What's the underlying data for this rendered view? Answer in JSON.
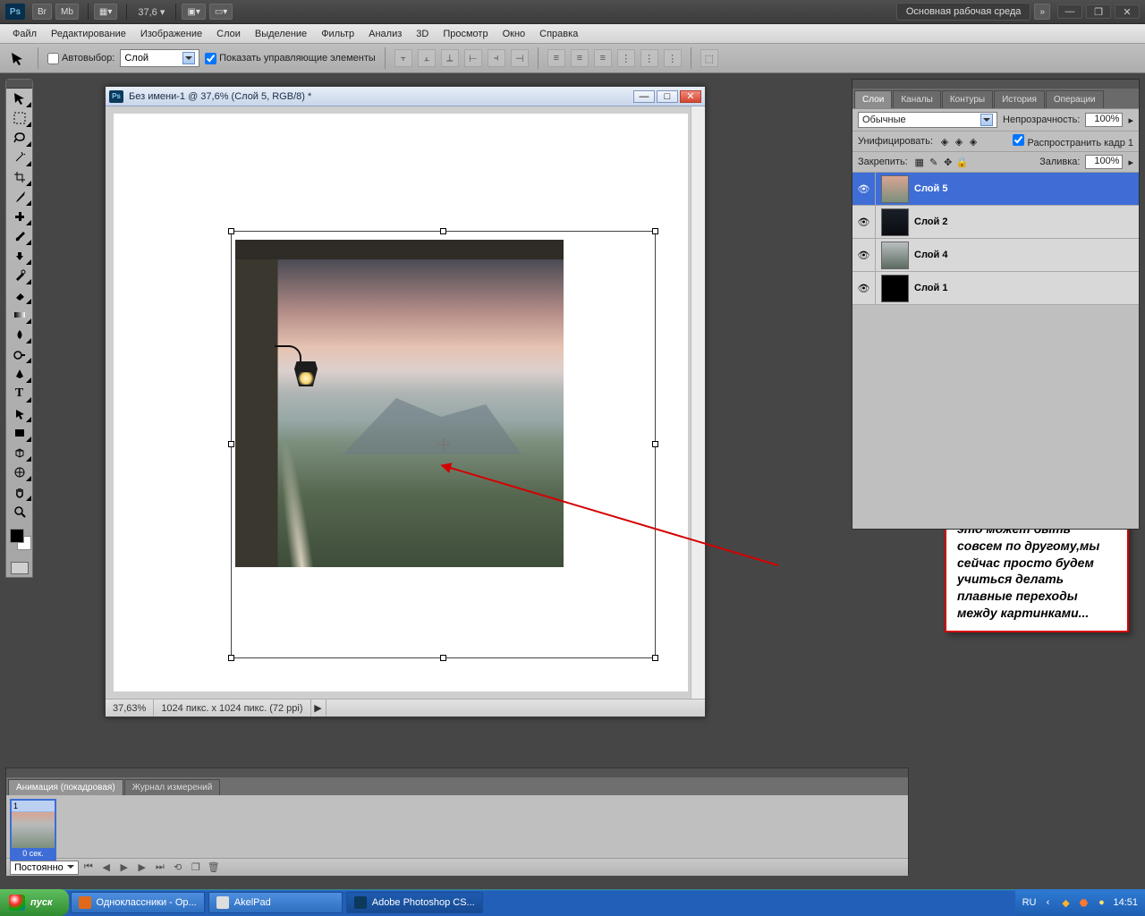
{
  "appbar": {
    "br_label": "Br",
    "mb_label": "Mb",
    "zoom": "37,6",
    "workspace_label": "Основная рабочая среда"
  },
  "menus": [
    "Файл",
    "Редактирование",
    "Изображение",
    "Слои",
    "Выделение",
    "Фильтр",
    "Анализ",
    "3D",
    "Просмотр",
    "Окно",
    "Справка"
  ],
  "options": {
    "auto_select": "Автовыбор:",
    "target_select": "Слой",
    "show_controls": "Показать управляющие элементы"
  },
  "document": {
    "title": "Без имени-1 @ 37,6% (Слой 5, RGB/8) *",
    "zoom": "37,63%",
    "info": "1024 пикс. x 1024 пикс. (72 ppi)"
  },
  "panels": {
    "tabs": [
      "Слои",
      "Каналы",
      "Контуры",
      "История",
      "Операции"
    ],
    "blend_mode": "Обычные",
    "opacity_label": "Непрозрачность:",
    "opacity_value": "100%",
    "unify_label": "Унифицировать:",
    "propagate_label": "Распространить кадр 1",
    "lock_label": "Закрепить:",
    "fill_label": "Заливка:",
    "fill_value": "100%",
    "layers": [
      {
        "name": "Слой 5",
        "thumb": "sky",
        "selected": true
      },
      {
        "name": "Слой 2",
        "thumb": "dark",
        "selected": false
      },
      {
        "name": "Слой 4",
        "thumb": "photo",
        "selected": false
      },
      {
        "name": "Слой 1",
        "thumb": "black",
        "selected": false
      }
    ]
  },
  "animation": {
    "tabs": [
      "Анимация (покадровая)",
      "Журнал измерений"
    ],
    "frame_num": "1",
    "frame_dur": "0 сек.",
    "loop": "Постоянно"
  },
  "callout_text": "вот так примерно я это поставила,но у вас это может быть совсем по другому,мы сейчас просто будем учиться делать плавные переходы между картинками...",
  "taskbar": {
    "start": "пуск",
    "items": [
      "Одноклассники - Op...",
      "AkelPad",
      "Adobe Photoshop CS..."
    ],
    "lang": "RU",
    "time": "14:51"
  }
}
